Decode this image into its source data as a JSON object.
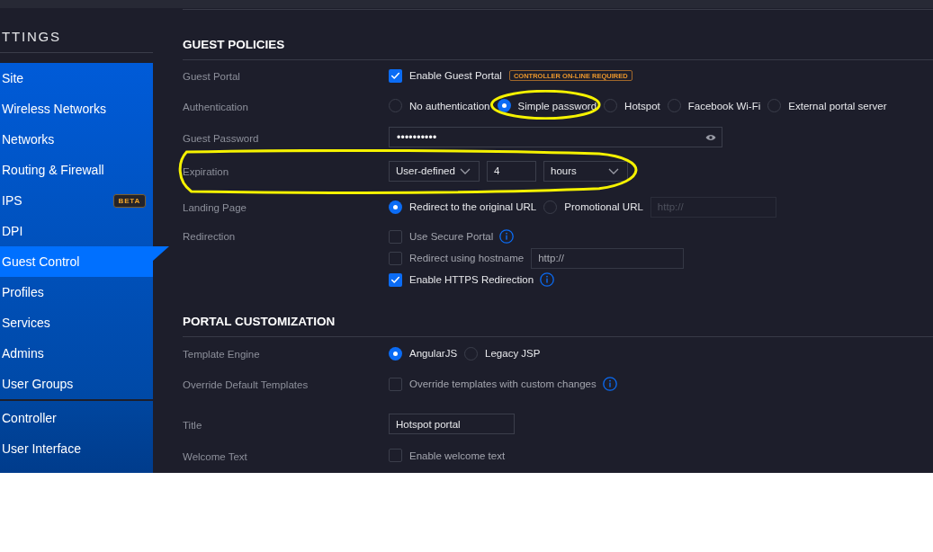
{
  "sidebar": {
    "title": "TTINGS",
    "groups": [
      {
        "items": [
          {
            "label": "Site",
            "selected": false
          },
          {
            "label": "Wireless Networks",
            "selected": false
          },
          {
            "label": "Networks",
            "selected": false
          },
          {
            "label": "Routing & Firewall",
            "selected": false
          },
          {
            "label": "IPS",
            "selected": false,
            "badge": "BETA"
          },
          {
            "label": "DPI",
            "selected": false
          },
          {
            "label": "Guest Control",
            "selected": true
          },
          {
            "label": "Profiles",
            "selected": false
          },
          {
            "label": "Services",
            "selected": false
          },
          {
            "label": "Admins",
            "selected": false
          },
          {
            "label": "User Groups",
            "selected": false
          }
        ]
      },
      {
        "items": [
          {
            "label": "Controller",
            "selected": false
          },
          {
            "label": "User Interface",
            "selected": false
          }
        ]
      }
    ]
  },
  "sections": [
    {
      "title": "GUEST POLICIES",
      "rows": [
        {
          "label": "Guest Portal",
          "highlighted": false,
          "lines": [
            [
              {
                "kind": "checkbox",
                "label": "Enable Guest Portal",
                "checked": true,
                "info": false,
                "badge": "CONTROLLER ON-LINE REQUIRED"
              }
            ]
          ]
        },
        {
          "label": "Authentication",
          "highlighted": false,
          "lines": [
            [
              {
                "kind": "radio",
                "label": "No authentication",
                "selected": false,
                "highlighted": false
              },
              {
                "kind": "radio",
                "label": "Simple password",
                "selected": true,
                "highlighted": true
              },
              {
                "kind": "radio",
                "label": "Hotspot",
                "selected": false,
                "highlighted": false
              },
              {
                "kind": "radio",
                "label": "Facebook Wi-Fi",
                "selected": false,
                "highlighted": false
              },
              {
                "kind": "radio",
                "label": "External portal server",
                "selected": false,
                "highlighted": false
              }
            ]
          ]
        },
        {
          "label": "Guest Password",
          "highlighted": false,
          "lines": [
            [
              {
                "kind": "password",
                "value": "••••••••••"
              }
            ]
          ]
        },
        {
          "label": "Expiration",
          "highlighted": true,
          "lines": [
            [
              {
                "kind": "select",
                "value": "User-defined"
              },
              {
                "kind": "number",
                "value": "4"
              },
              {
                "kind": "select",
                "value": "hours"
              }
            ]
          ]
        },
        {
          "label": "Landing Page",
          "highlighted": false,
          "lines": [
            [
              {
                "kind": "radio",
                "label": "Redirect to the original URL",
                "selected": true,
                "highlighted": false
              },
              {
                "kind": "radio",
                "label": "Promotional URL",
                "selected": false,
                "highlighted": false
              },
              {
                "kind": "url",
                "placeholder": "http://",
                "disabled": true
              }
            ]
          ]
        },
        {
          "label": "Redirection",
          "highlighted": false,
          "lines": [
            [
              {
                "kind": "checkbox",
                "label": "Use Secure Portal",
                "checked": false,
                "info": true
              }
            ],
            [
              {
                "kind": "checkbox",
                "label": "Redirect using hostname",
                "checked": false,
                "info": false
              },
              {
                "kind": "url",
                "placeholder": "http://",
                "disabled": false
              }
            ],
            [
              {
                "kind": "checkbox",
                "label": "Enable HTTPS Redirection",
                "checked": true,
                "info": true
              }
            ]
          ]
        }
      ]
    },
    {
      "title": "PORTAL CUSTOMIZATION",
      "rows": [
        {
          "label": "Template Engine",
          "highlighted": false,
          "lines": [
            [
              {
                "kind": "radio",
                "label": "AngularJS",
                "selected": true,
                "highlighted": false
              },
              {
                "kind": "radio",
                "label": "Legacy JSP",
                "selected": false,
                "highlighted": false
              }
            ]
          ]
        },
        {
          "label": "Override Default Templates",
          "highlighted": false,
          "lines": [
            [
              {
                "kind": "checkbox",
                "label": "Override templates with custom changes",
                "checked": false,
                "info": true
              }
            ]
          ]
        },
        {
          "label": "Title",
          "highlighted": false,
          "lines": [
            [
              {
                "kind": "text",
                "value": "Hotspot portal"
              }
            ]
          ]
        },
        {
          "label": "Welcome Text",
          "highlighted": false,
          "lines": [
            [
              {
                "kind": "checkbox",
                "label": "Enable welcome text",
                "checked": false,
                "info": false
              }
            ]
          ]
        }
      ]
    }
  ]
}
